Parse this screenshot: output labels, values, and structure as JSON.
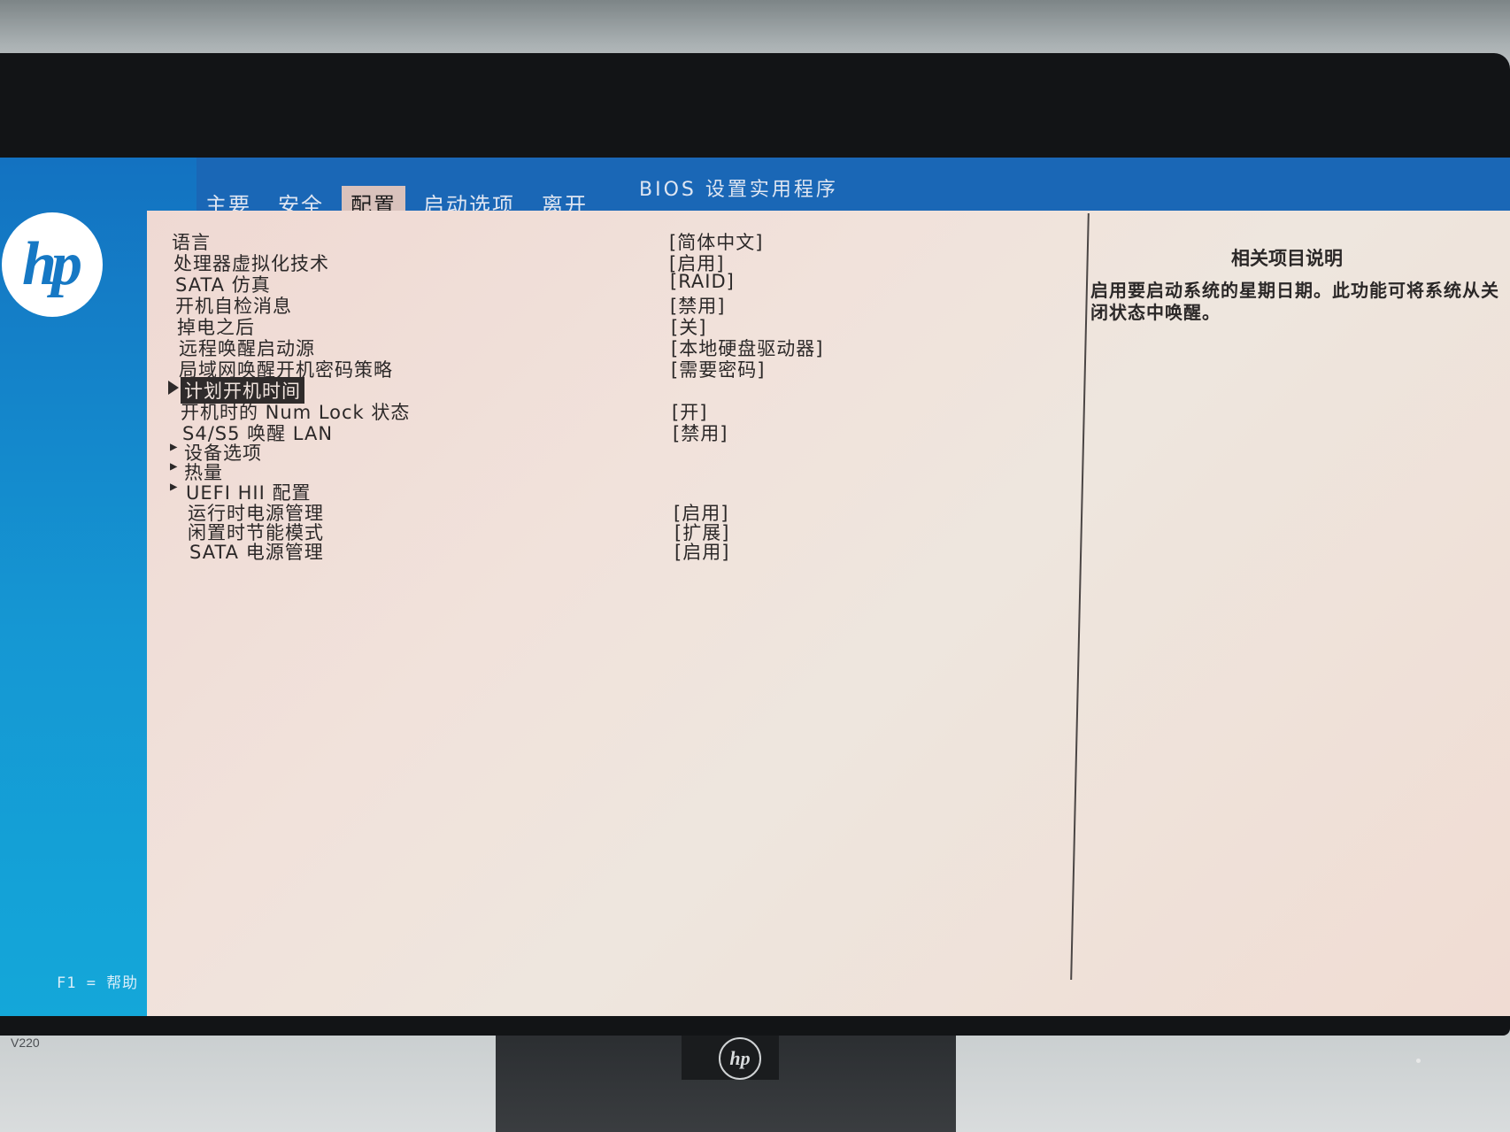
{
  "header": {
    "title": "BIOS 设置实用程序",
    "tabs": [
      {
        "label": "主要",
        "active": false
      },
      {
        "label": "安全",
        "active": false
      },
      {
        "label": "配置",
        "active": true
      },
      {
        "label": "启动选项",
        "active": false
      },
      {
        "label": "离开",
        "active": false
      }
    ]
  },
  "logo": {
    "text": "hp"
  },
  "settings": [
    {
      "label": "语言",
      "value": "[简体中文]"
    },
    {
      "label": "处理器虚拟化技术",
      "value": "[启用]"
    },
    {
      "label": "SATA 仿真",
      "value": "[RAID]"
    },
    {
      "label": "开机自检消息",
      "value": "[禁用]"
    },
    {
      "label": "掉电之后",
      "value": "[关]"
    },
    {
      "label": "远程唤醒启动源",
      "value": "[本地硬盘驱动器]"
    },
    {
      "label": "局域网唤醒开机密码策略",
      "value": "[需要密码]"
    },
    {
      "label": "计划开机时间",
      "value": "",
      "selected": true
    },
    {
      "label": "开机时的 Num Lock 状态",
      "value": "[开]"
    },
    {
      "label": "S4/S5 唤醒 LAN",
      "value": "[禁用]"
    },
    {
      "label": "设备选项",
      "value": "",
      "submenu": true
    },
    {
      "label": "热量",
      "value": "",
      "submenu": true
    },
    {
      "label": "UEFI HII 配置",
      "value": "",
      "submenu": true
    },
    {
      "label": "运行时电源管理",
      "value": "[启用]"
    },
    {
      "label": "闲置时节能模式",
      "value": "[扩展]"
    },
    {
      "label": "SATA 电源管理",
      "value": "[启用]"
    }
  ],
  "help": {
    "title": "相关项目说明",
    "text": "启用要启动系统的星期日期。此功能可将系统从关闭状态中唤醒。"
  },
  "footer": {
    "help_hint": "F1 = 帮助"
  },
  "monitor": {
    "model_label": "V220"
  }
}
